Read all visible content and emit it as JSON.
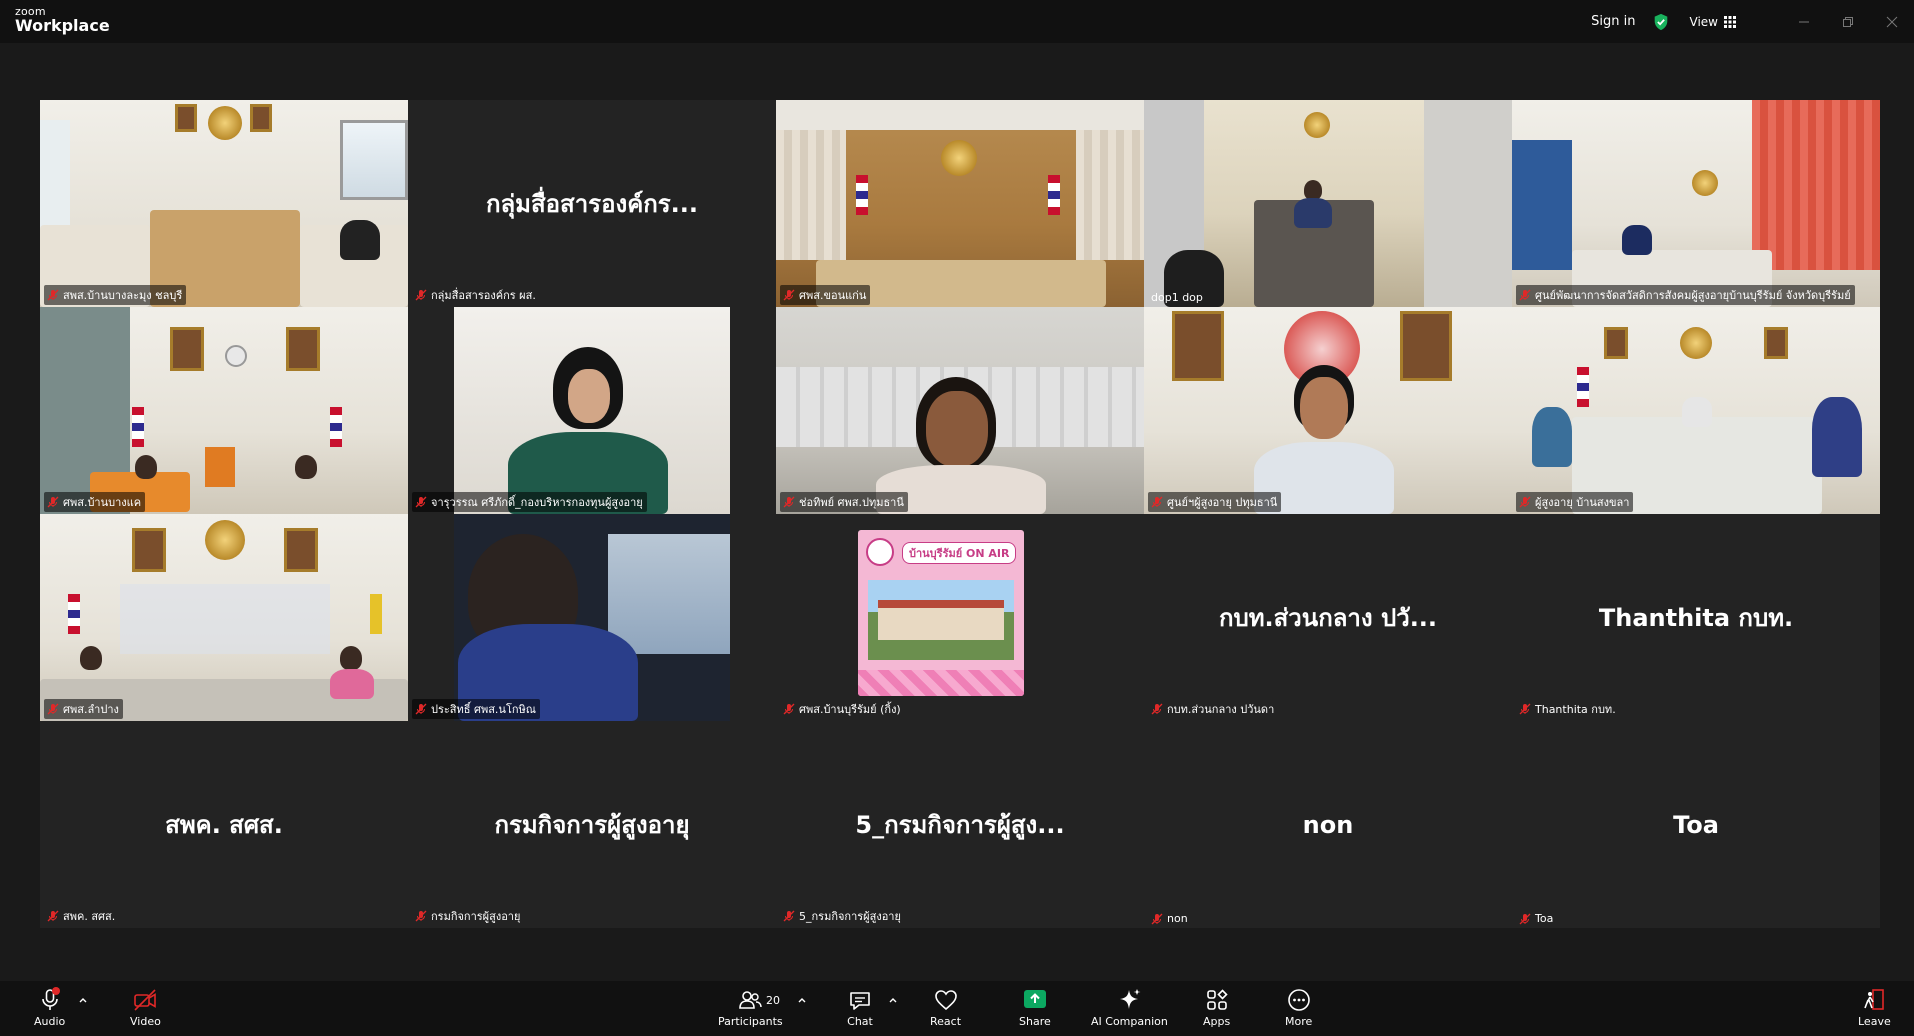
{
  "app": {
    "brand_small": "zoom",
    "brand_name": "Workplace",
    "sign_in": "Sign in",
    "view": "View"
  },
  "tiles": [
    {
      "name": "สพส.บ้านบางละมุง ชลบุรี",
      "big": "",
      "video": true
    },
    {
      "name": "กลุ่มสื่อสารองค์กร ผส.",
      "big": "กลุ่มสื่อสารองค์กร...",
      "video": false
    },
    {
      "name": "ศพส.ขอนแก่น",
      "big": "",
      "video": true
    },
    {
      "name": "dop1 dop",
      "big": "",
      "video": true,
      "active": true
    },
    {
      "name": "ศูนย์พัฒนาการจัดสวัสดิการสังคมผู้สูงอายุบ้านบุรีรัมย์ จังหวัดบุรีรัมย์",
      "big": "",
      "video": true
    },
    {
      "name": "ศพส.บ้านบางแค",
      "big": "",
      "video": true
    },
    {
      "name": "จารุวรรณ ศรีภักดิ์_กองบริหารกองทุนผู้สูงอายุ",
      "big": "",
      "video": true
    },
    {
      "name": "ช่อทิพย์ ศพส.ปทุมธานี",
      "big": "",
      "video": true
    },
    {
      "name": "ศูนย์ฯผู้สูงอายุ ปทุมธานี",
      "big": "",
      "video": true
    },
    {
      "name": "ผู้สูงอายุ บ้านสงขลา",
      "big": "",
      "video": true
    },
    {
      "name": "ศพส.ลำปาง",
      "big": "",
      "video": true
    },
    {
      "name": "ประสิทธิ์ ศพส.นโกษิณ",
      "big": "",
      "video": true
    },
    {
      "name": "ศพส.บ้านบุรีรัมย์ (กิ้ง)",
      "big": "",
      "video": true,
      "thumb_title": "บ้านบุรีรัมย์ ON AIR"
    },
    {
      "name": "กบท.ส่วนกลาง ปวันดา",
      "big": "กบท.ส่วนกลาง ปวั...",
      "video": false
    },
    {
      "name": "Thanthita กบท.",
      "big": "Thanthita กบท.",
      "video": false
    },
    {
      "name": "สพค. สศส.",
      "big": "สพค. สศส.",
      "video": false
    },
    {
      "name": "กรมกิจการผู้สูงอายุ",
      "big": "กรมกิจการผู้สูงอายุ",
      "video": false
    },
    {
      "name": "5_กรมกิจการผู้สูงอายุ",
      "big": "5_กรมกิจการผู้สูง...",
      "video": false
    },
    {
      "name": "non",
      "big": "non",
      "video": false
    },
    {
      "name": "Toa",
      "big": "Toa",
      "video": false
    }
  ],
  "toolbar": {
    "audio": "Audio",
    "video": "Video",
    "participants": "Participants",
    "participants_count": "20",
    "chat": "Chat",
    "react": "React",
    "share": "Share",
    "ai_companion": "AI Companion",
    "apps": "Apps",
    "more": "More",
    "leave": "Leave"
  },
  "colors": {
    "background": "#1a1a1a",
    "bar": "#111111",
    "tile": "#232323",
    "active_speaker": "#1fc78a",
    "share_green": "#0ca861",
    "mute_red": "#e02828",
    "leave_red": "#e02828"
  }
}
